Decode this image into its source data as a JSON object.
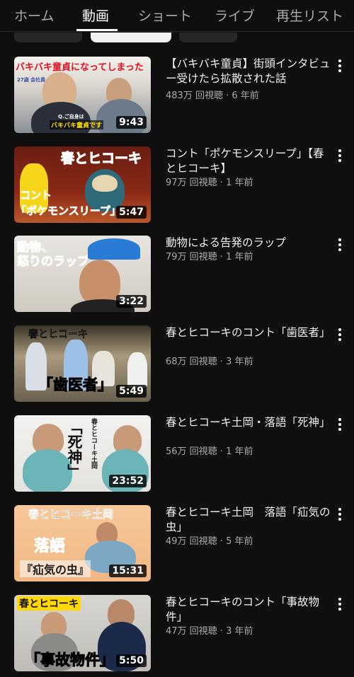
{
  "tabs": [
    {
      "label": "ホーム",
      "active": false
    },
    {
      "label": "動画",
      "active": true
    },
    {
      "label": "ショート",
      "active": false
    },
    {
      "label": "ライブ",
      "active": false
    },
    {
      "label": "再生リスト",
      "active": false
    }
  ],
  "videos": [
    {
      "title": "【バキバキ童貞】街頭インタビュー受けたら拡散された話",
      "meta": "483万 回視聴 · 6 年前",
      "duration": "9:43",
      "thumb_text": [
        "バキバキ童貞になってしまった",
        "Q.ご自身は",
        "バキバキ童貞です",
        "27歳 会社員"
      ]
    },
    {
      "title": "コント「ポケモンスリープ」【春とヒコーキ】",
      "meta": "97万 回視聴 · 1 年前",
      "duration": "5:47",
      "thumb_text": [
        "春とヒコーキ",
        "コント",
        "「ポケモンスリープ」"
      ]
    },
    {
      "title": "動物による告発のラップ",
      "meta": "79万 回視聴 · 1 年前",
      "duration": "3:22",
      "thumb_text": [
        "動物、",
        "怒りのラップ"
      ]
    },
    {
      "title": "春とヒコーキのコント「歯医者」",
      "meta": "68万 回視聴 · 3 年前",
      "duration": "5:49",
      "thumb_text": [
        "春とヒコーキ",
        "「歯医者」"
      ]
    },
    {
      "title": "春とヒコーキ土岡・落語「死神」",
      "meta": "56万 回視聴 · 1 年前",
      "duration": "23:52",
      "thumb_text": [
        "「死神」",
        "春とヒコーキ土岡"
      ]
    },
    {
      "title": "春とヒコーキ土岡　落語「疝気の虫」",
      "meta": "49万 回視聴 · 5 年前",
      "duration": "15:31",
      "thumb_text": [
        "春とヒコーキ土岡",
        "落語",
        "『疝気の虫』"
      ]
    },
    {
      "title": "春とヒコーキのコント「事故物件」",
      "meta": "47万 回視聴 · 3 年前",
      "duration": "5:50",
      "thumb_text": [
        "春とヒコーキ",
        "「事故物件」"
      ]
    }
  ]
}
